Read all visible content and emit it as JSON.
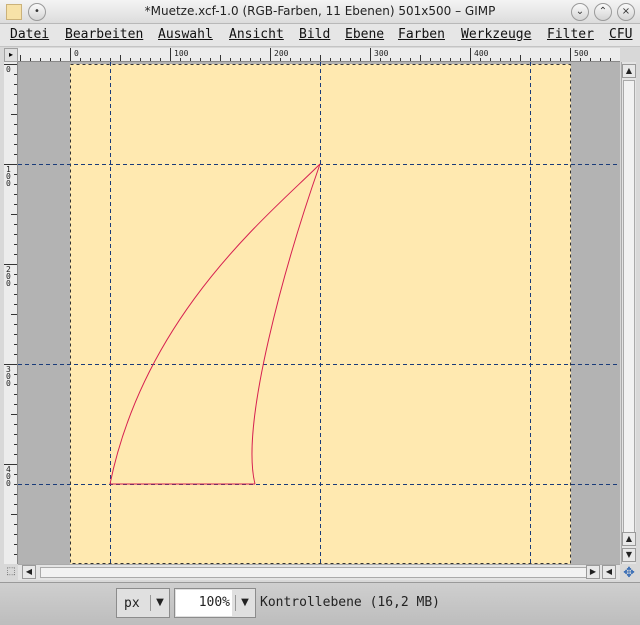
{
  "window": {
    "title": "*Muetze.xcf-1.0 (RGB-Farben, 11 Ebenen) 501x500 – GIMP",
    "minimize_glyph": "⌄",
    "maximize_glyph": "⌃",
    "close_glyph": "×",
    "menu_glyph": "•"
  },
  "menu": [
    "Datei",
    "Bearbeiten",
    "Auswahl",
    "Ansicht",
    "Bild",
    "Ebene",
    "Farben",
    "Werkzeuge",
    "Filter",
    "CFU"
  ],
  "ruler": {
    "horizontal_labels": [
      "0",
      "100",
      "200",
      "300",
      "400",
      "500"
    ],
    "vertical_labels": [
      "0",
      "100",
      "200",
      "300",
      "400"
    ]
  },
  "image": {
    "width": 501,
    "height": 500,
    "fill_color": "#ffe9b0",
    "background_color": "#b3b3b3",
    "guide_color": "#1a3c7a",
    "path_color": "#d62050",
    "guides_vertical": [
      40,
      250,
      460
    ],
    "guides_horizontal": [
      100,
      300,
      420
    ],
    "path_outer": [
      [
        40,
        420
      ],
      [
        75,
        250
      ],
      [
        200,
        150
      ],
      [
        250,
        100
      ]
    ],
    "path_inner": [
      [
        250,
        100
      ],
      [
        215,
        200
      ],
      [
        170,
        360
      ],
      [
        185,
        420
      ]
    ],
    "path_base": [
      [
        40,
        420
      ],
      [
        185,
        420
      ]
    ]
  },
  "status": {
    "unit": "px",
    "zoom": "100",
    "zoom_unit": "%",
    "layer_info": "Kontrollebene (16,2 MB)"
  },
  "icons": {
    "arrow_up": "▲",
    "arrow_down": "▼",
    "arrow_left": "◀",
    "arrow_right": "▶",
    "ruler_corner": "▸",
    "quickmask": "⬚",
    "navigate": "✥"
  }
}
